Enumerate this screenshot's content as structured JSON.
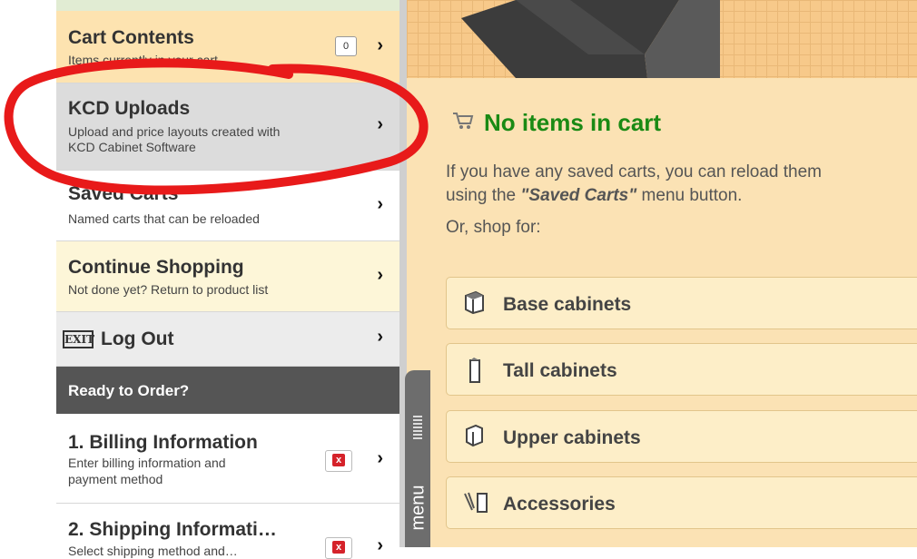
{
  "sidebar": {
    "cart_contents": {
      "title": "Cart Contents",
      "subtitle": "Items currently in your cart",
      "count": "0"
    },
    "kcd_uploads": {
      "title": "KCD Uploads",
      "subtitle_line1": "Upload and price layouts created with",
      "subtitle_line2": "KCD Cabinet Software"
    },
    "saved_carts": {
      "title": "Saved Carts",
      "subtitle": "Named carts that can be reloaded"
    },
    "continue_shopping": {
      "title": "Continue Shopping",
      "subtitle": "Not done yet? Return to product list"
    },
    "log_out": {
      "title": "Log Out",
      "icon_text": "EXIT"
    },
    "ready_header": "Ready to Order?",
    "billing": {
      "title": "1. Billing Information",
      "subtitle_line1": "Enter billing information and",
      "subtitle_line2": "payment method",
      "status": "x"
    },
    "shipping": {
      "title": "2. Shipping Informati…",
      "subtitle": "Select shipping method and…",
      "status": "x"
    }
  },
  "menu_tab": {
    "label": "menu"
  },
  "main": {
    "no_items_heading": "No items in cart",
    "message_line1": "If you have any saved carts, you can reload them",
    "message_line2_prefix": "using the ",
    "message_line2_emph": "\"Saved Carts\"",
    "message_line2_suffix": " menu button.",
    "shop_for": "Or, shop for:",
    "categories": [
      {
        "label": "Base cabinets",
        "icon": "base-cabinet-icon"
      },
      {
        "label": "Tall cabinets",
        "icon": "tall-cabinet-icon"
      },
      {
        "label": "Upper cabinets",
        "icon": "upper-cabinet-icon"
      },
      {
        "label": "Accessories",
        "icon": "accessories-icon"
      }
    ]
  },
  "colors": {
    "annotation": "#e81a1a",
    "heading_green": "#1a8a14",
    "dark_header": "#555555",
    "cream": "#fdf6d8",
    "kcd_bg": "#dcdcdc",
    "cart_bg": "#fde3b0"
  }
}
